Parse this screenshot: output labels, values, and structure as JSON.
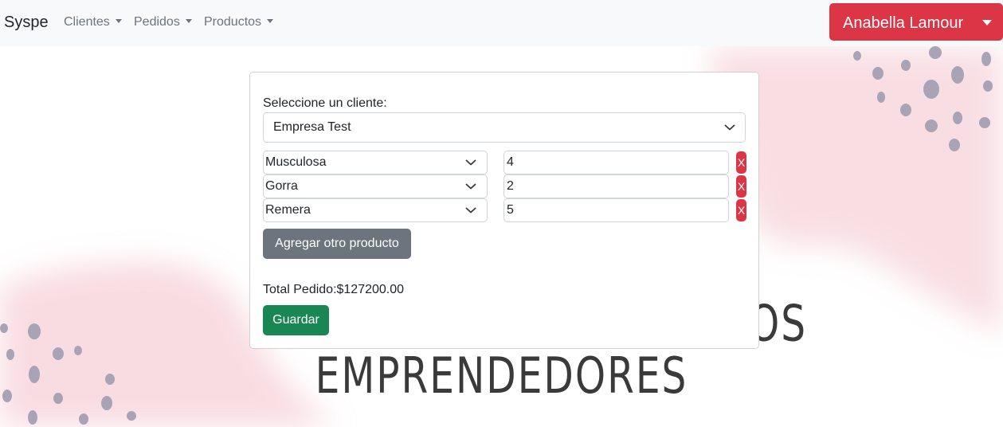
{
  "navbar": {
    "brand": "Syspe",
    "menus": [
      {
        "label": "Clientes"
      },
      {
        "label": "Pedidos"
      },
      {
        "label": "Productos"
      }
    ],
    "user": "Anabella Lamour"
  },
  "hero": {
    "line1": "OS",
    "line2": "EMPRENDEDORES"
  },
  "form": {
    "client_label": "Seleccione un cliente:",
    "client_selected": "Empresa Test",
    "items": [
      {
        "product": "Musculosa",
        "quantity": "4",
        "remove": "X"
      },
      {
        "product": "Gorra",
        "quantity": "2",
        "remove": "X"
      },
      {
        "product": "Remera",
        "quantity": "5",
        "remove": "X"
      }
    ],
    "add_label": "Agregar otro producto",
    "total_label": "Total Pedido:$127200.00",
    "save_label": "Guardar"
  },
  "colors": {
    "danger": "#dc3545",
    "secondary": "#6c757d",
    "success": "#198754",
    "navbar_bg": "#f8f9fa",
    "dots": "#a9a3b6",
    "watercolor": "#f4c5cf"
  }
}
